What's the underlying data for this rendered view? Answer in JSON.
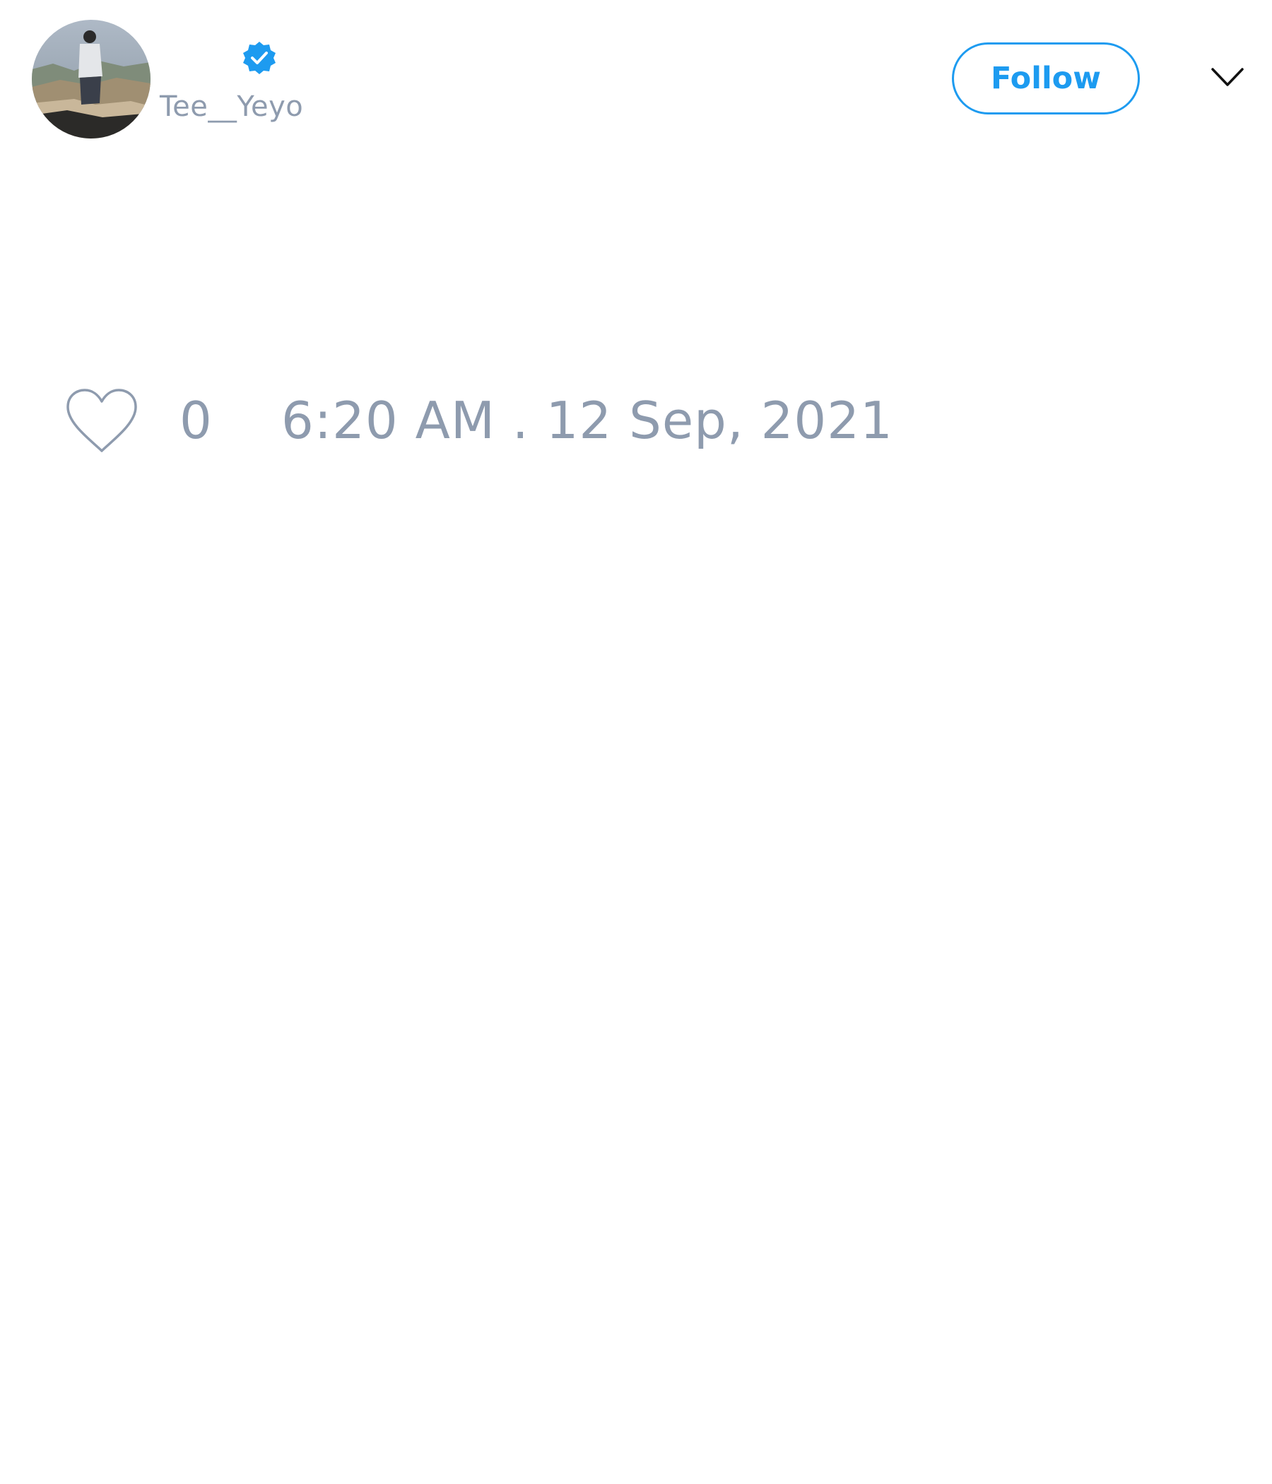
{
  "user": {
    "handle": "Tee__Yeyo",
    "verified": true,
    "avatar_icon": "profile-photo-person-overlooking-landscape"
  },
  "header": {
    "follow_label": "Follow",
    "menu_icon": "chevron-down-icon"
  },
  "tweet": {
    "like_icon": "heart-outline-icon",
    "like_count": "0",
    "timestamp": "6:20 AM . 12 Sep, 2021"
  },
  "colors": {
    "accent": "#1d9bf0",
    "muted_text": "#8e9bae",
    "background": "#ffffff"
  }
}
